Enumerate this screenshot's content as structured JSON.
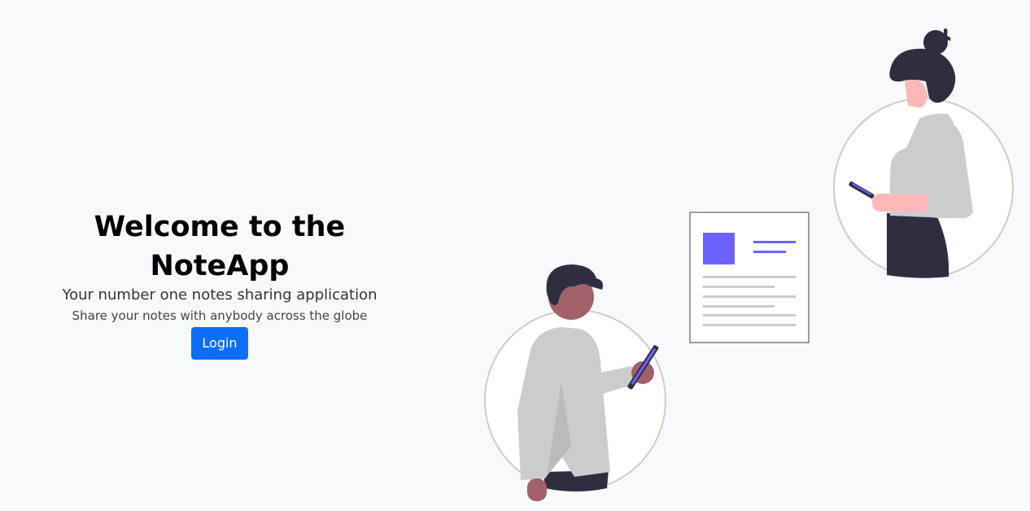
{
  "hero": {
    "title": "Welcome to the NoteApp",
    "subtitle": "Your number one notes sharing application",
    "tagline": "Share your notes with anybody across the globe",
    "login_label": "Login"
  },
  "colors": {
    "accent": "#0d6efd",
    "illustration_purple": "#6c63ff",
    "hair": "#2f2e41",
    "shirt": "#cccccc"
  }
}
